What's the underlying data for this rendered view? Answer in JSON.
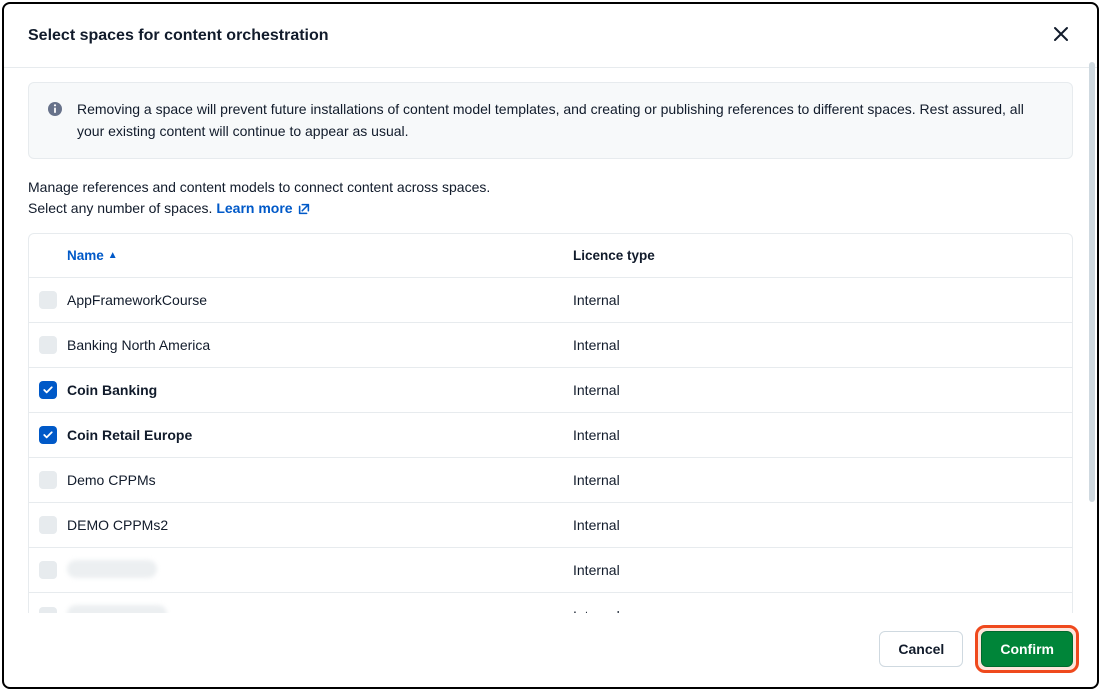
{
  "modal": {
    "title": "Select spaces for content orchestration",
    "info_banner": "Removing a space will prevent future installations of content model templates, and creating or publishing references to different spaces. Rest assured, all your existing content will continue to appear as usual.",
    "intro_line1": "Manage references and content models to connect content across spaces.",
    "intro_line2": "Select any number of spaces.",
    "learn_more": "Learn more"
  },
  "table": {
    "headers": {
      "name": "Name",
      "licence": "Licence type"
    },
    "rows": [
      {
        "name": "AppFrameworkCourse",
        "licence": "Internal",
        "checked": false,
        "blurred": false
      },
      {
        "name": "Banking North America",
        "licence": "Internal",
        "checked": false,
        "blurred": false
      },
      {
        "name": "Coin Banking",
        "licence": "Internal",
        "checked": true,
        "blurred": false
      },
      {
        "name": "Coin Retail Europe",
        "licence": "Internal",
        "checked": true,
        "blurred": false
      },
      {
        "name": "Demo CPPMs",
        "licence": "Internal",
        "checked": false,
        "blurred": false
      },
      {
        "name": "DEMO CPPMs2",
        "licence": "Internal",
        "checked": false,
        "blurred": false
      },
      {
        "name": "",
        "licence": "Internal",
        "checked": false,
        "blurred": true
      },
      {
        "name": "",
        "licence": "Internal",
        "checked": false,
        "blurred": true
      }
    ]
  },
  "footer": {
    "cancel": "Cancel",
    "confirm": "Confirm"
  }
}
